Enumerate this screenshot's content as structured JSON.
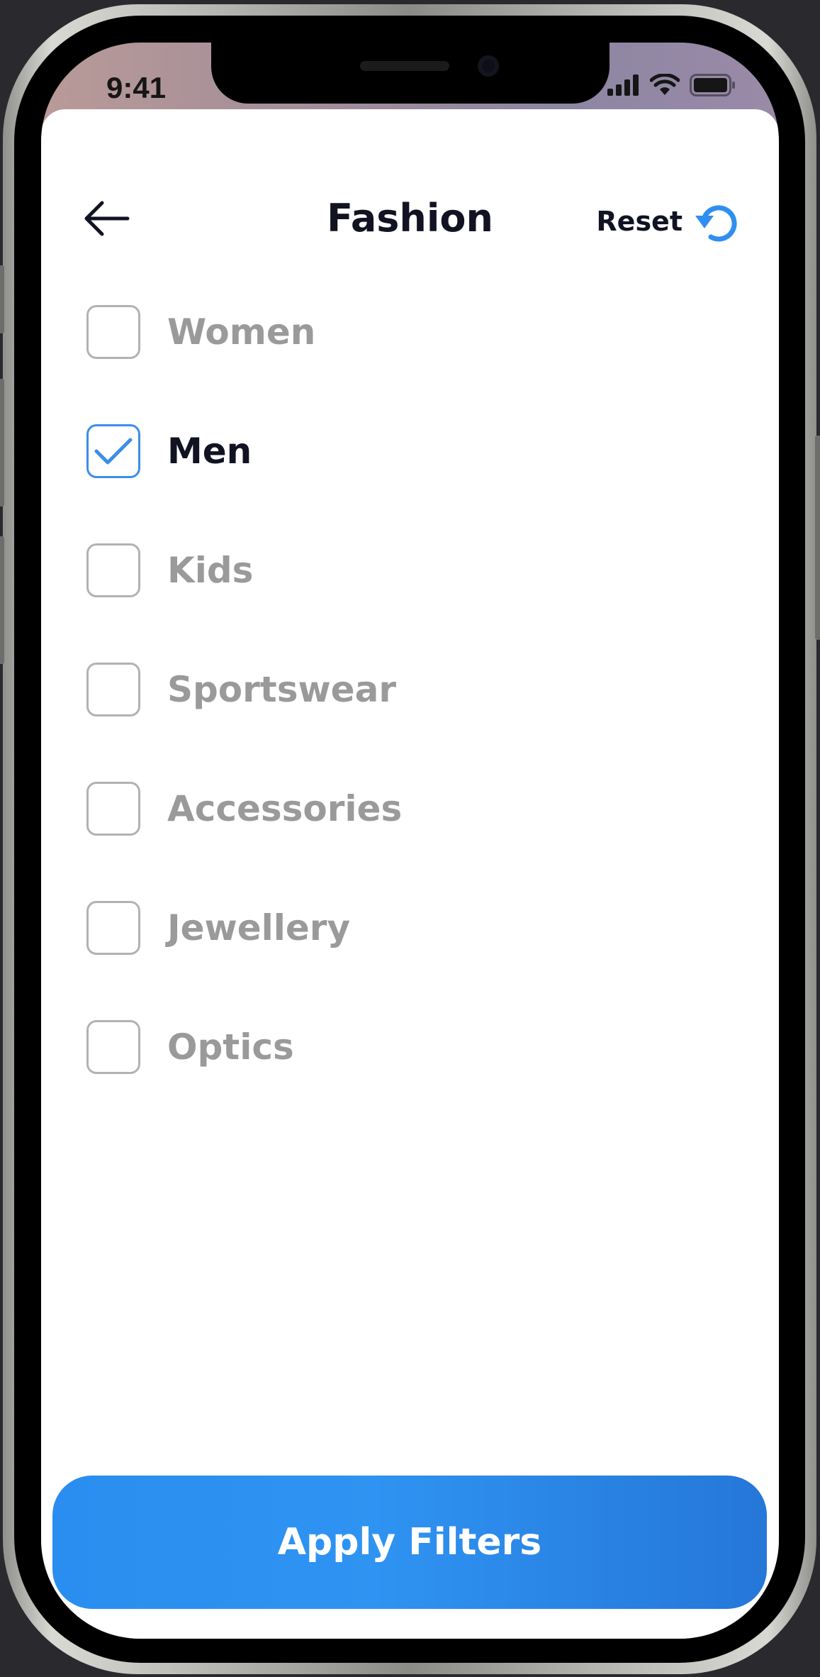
{
  "status_bar": {
    "time": "9:41"
  },
  "header": {
    "title": "Fashion",
    "reset_label": "Reset"
  },
  "options": [
    {
      "label": "Women",
      "checked": false
    },
    {
      "label": "Men",
      "checked": true
    },
    {
      "label": "Kids",
      "checked": false
    },
    {
      "label": "Sportswear",
      "checked": false
    },
    {
      "label": "Accessories",
      "checked": false
    },
    {
      "label": "Jewellery",
      "checked": false
    },
    {
      "label": "Optics",
      "checked": false
    }
  ],
  "footer": {
    "apply_label": "Apply Filters"
  },
  "colors": {
    "accent": "#2f8ff0",
    "title_text": "#111322",
    "muted_text": "#9a9a9a",
    "checkbox_border": "#b2b2b2"
  },
  "icons": {
    "back": "arrow-left-icon",
    "reset": "refresh-icon",
    "check": "checkmark-icon"
  }
}
